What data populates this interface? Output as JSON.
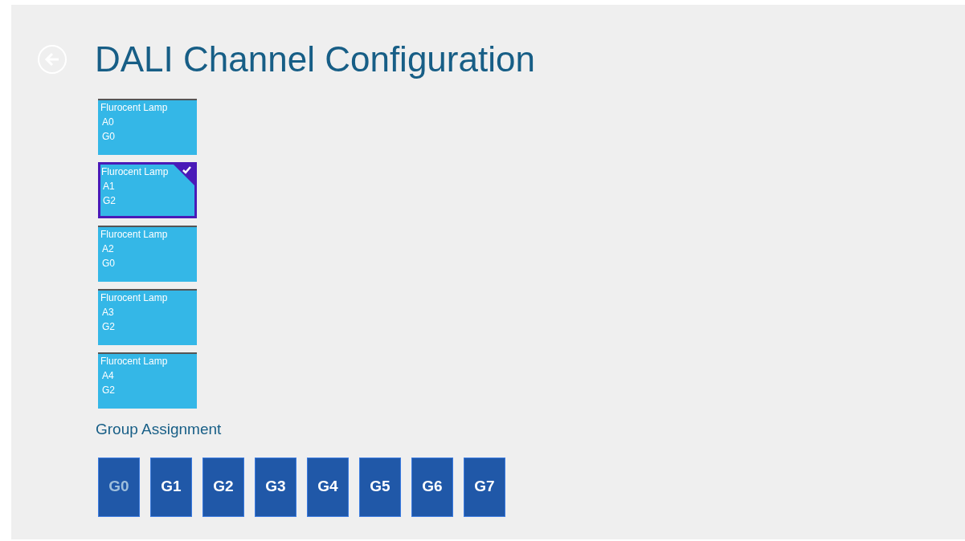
{
  "page": {
    "title": "DALI Channel Configuration"
  },
  "channels": [
    {
      "name": "Flurocent Lamp",
      "address": "A0",
      "group": "G0",
      "selected": false
    },
    {
      "name": "Flurocent Lamp",
      "address": "A1",
      "group": "G2",
      "selected": true
    },
    {
      "name": "Flurocent Lamp",
      "address": "A2",
      "group": "G0",
      "selected": false
    },
    {
      "name": "Flurocent Lamp",
      "address": "A3",
      "group": "G2",
      "selected": false
    },
    {
      "name": "Flurocent Lamp",
      "address": "A4",
      "group": "G2",
      "selected": false
    }
  ],
  "group_assignment": {
    "heading": "Group Assignment",
    "groups": [
      {
        "label": "G0",
        "disabled": true
      },
      {
        "label": "G1",
        "disabled": false
      },
      {
        "label": "G2",
        "disabled": false
      },
      {
        "label": "G3",
        "disabled": false
      },
      {
        "label": "G4",
        "disabled": false
      },
      {
        "label": "G5",
        "disabled": false
      },
      {
        "label": "G6",
        "disabled": false
      },
      {
        "label": "G7",
        "disabled": false
      }
    ]
  }
}
